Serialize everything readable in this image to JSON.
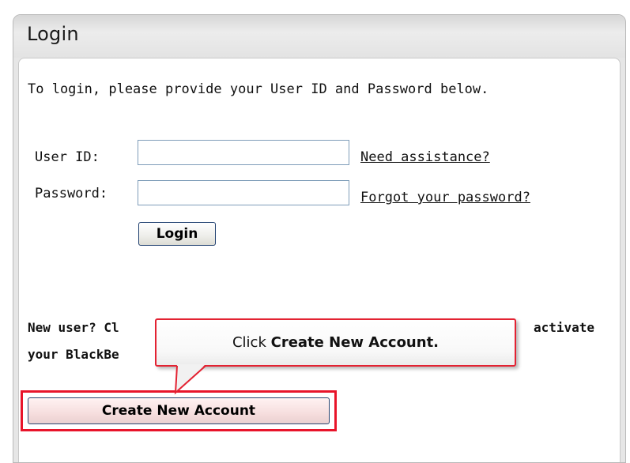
{
  "login": {
    "title": "Login",
    "intro": "To login, please provide your User ID and Password below.",
    "user_id_label": "User ID:",
    "user_id_value": "",
    "password_label": "Password:",
    "password_value": "",
    "need_assistance": "Need assistance?",
    "forgot_password": "Forgot your password?",
    "login_button": "Login",
    "new_user_line1_start": "New user? Cl",
    "new_user_line1_end": "activate",
    "new_user_line2": "your BlackBe",
    "create_account_button": "Create New Account"
  },
  "callout": {
    "prefix": "Click ",
    "action": "Create New Account.",
    "border_color": "#e32232"
  }
}
